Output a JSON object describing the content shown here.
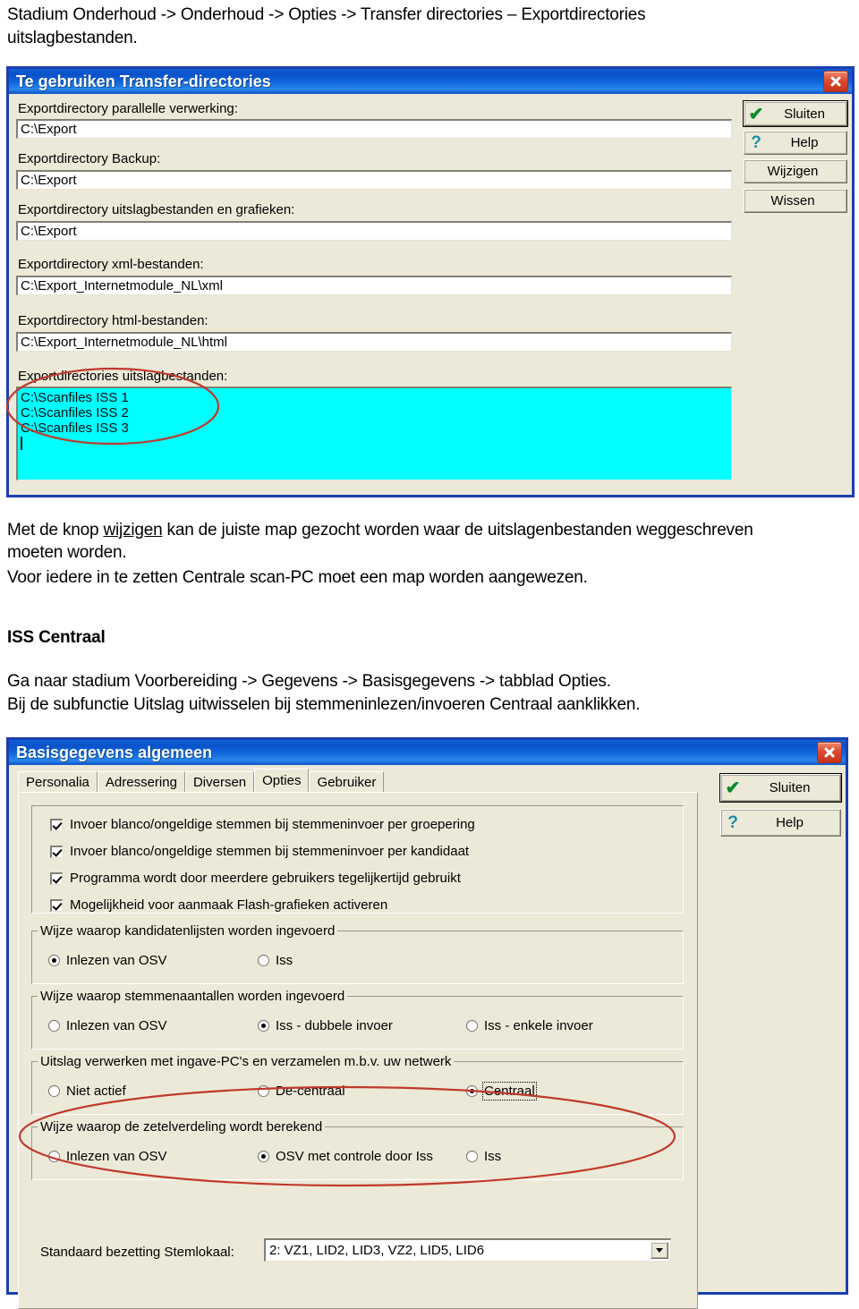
{
  "doc": {
    "intro_line1": "Stadium Onderhoud -> Onderhoud -> Opties -> Transfer directories – Exportdirectories",
    "intro_line2": "uitslagbestanden.",
    "para1_pre": "Met de knop ",
    "para1_link": "wijzigen",
    "para1_post": " kan de juiste map gezocht worden waar de uitslagenbestanden  weggeschreven",
    "para1_line2": "moeten worden.",
    "para2": "Voor iedere in te zetten Centrale scan-PC moet een map worden aangewezen.",
    "heading": "ISS Centraal",
    "para3": "Ga naar stadium Voorbereiding -> Gegevens -> Basisgegevens -> tabblad Opties.",
    "para4": "Bij de subfunctie Uitslag uitwisselen bij stemmeninlezen/invoeren Centraal aanklikken."
  },
  "dialog1": {
    "title": "Te gebruiken Transfer-directories",
    "close_icon": "close-icon",
    "fields": [
      {
        "label": "Exportdirectory parallelle verwerking:",
        "value": "C:\\Export"
      },
      {
        "label": "Exportdirectory Backup:",
        "value": "C:\\Export"
      },
      {
        "label": "Exportdirectory uitslagbestanden en grafieken:",
        "value": "C:\\Export"
      },
      {
        "label": "Exportdirectory xml-bestanden:",
        "value": "C:\\Export_Internetmodule_NL\\xml"
      },
      {
        "label": "Exportdirectory html-bestanden:",
        "value": "C:\\Export_Internetmodule_NL\\html"
      }
    ],
    "list_label": "Exportdirectories uitslagbestanden:",
    "list_items": [
      "C:\\Scanfiles ISS 1",
      "C:\\Scanfiles ISS 2",
      "C:\\Scanfiles ISS 3"
    ],
    "list_bg_color": "#00ffff",
    "buttons": [
      {
        "label": "Sluiten",
        "icon": "checkmark-icon",
        "glyph": "✔",
        "default": true
      },
      {
        "label": "Help",
        "icon": "question-mark-icon",
        "glyph": "?",
        "default": false
      },
      {
        "label": "Wijzigen",
        "icon": "",
        "glyph": "",
        "default": false
      },
      {
        "label": "Wissen",
        "icon": "",
        "glyph": "",
        "default": false
      }
    ]
  },
  "dialog2": {
    "title": "Basisgegevens algemeen",
    "close_icon": "close-icon",
    "tabs": [
      {
        "label": "Personalia",
        "active": false
      },
      {
        "label": "Adressering",
        "active": false
      },
      {
        "label": "Diversen",
        "active": false
      },
      {
        "label": "Opties",
        "active": true
      },
      {
        "label": "Gebruiker",
        "active": false
      }
    ],
    "checkboxes": [
      {
        "label": "Invoer blanco/ongeldige stemmen bij stemmeninvoer per groepering",
        "checked": true
      },
      {
        "label": "Invoer blanco/ongeldige stemmen bij stemmeninvoer per kandidaat",
        "checked": true
      },
      {
        "label": "Programma wordt door meerdere gebruikers tegelijkertijd gebruikt",
        "checked": true
      },
      {
        "label": "Mogelijkheid voor aanmaak Flash-grafieken activeren",
        "checked": true
      }
    ],
    "groups": [
      {
        "title": "Wijze waarop kandidatenlijsten worden ingevoerd",
        "options": [
          {
            "label": "Inlezen van OSV",
            "selected": true,
            "focused": false
          },
          {
            "label": "Iss",
            "selected": false,
            "focused": false
          }
        ]
      },
      {
        "title": "Wijze waarop stemmenaantallen worden ingevoerd",
        "options": [
          {
            "label": "Inlezen van OSV",
            "selected": false,
            "focused": false
          },
          {
            "label": "Iss - dubbele invoer",
            "selected": true,
            "focused": false
          },
          {
            "label": "Iss - enkele invoer",
            "selected": false,
            "focused": false
          }
        ]
      },
      {
        "title": "Uitslag verwerken met ingave-PC's en verzamelen m.b.v. uw netwerk",
        "options": [
          {
            "label": "Niet actief",
            "selected": false,
            "focused": false
          },
          {
            "label": "De-centraal",
            "selected": false,
            "focused": false
          },
          {
            "label": "Centraal",
            "selected": true,
            "focused": true
          }
        ]
      },
      {
        "title": "Wijze waarop de zetelverdeling wordt berekend",
        "options": [
          {
            "label": "Inlezen van OSV",
            "selected": false,
            "focused": false
          },
          {
            "label": "OSV met controle door Iss",
            "selected": true,
            "focused": false
          },
          {
            "label": "Iss",
            "selected": false,
            "focused": false
          }
        ]
      }
    ],
    "combo": {
      "label": "Standaard bezetting Stemlokaal:",
      "value": "2: VZ1, LID2, LID3, VZ2, LID5, LID6"
    },
    "buttons": [
      {
        "label": "Sluiten",
        "icon": "checkmark-icon",
        "glyph": "✔",
        "default": true
      },
      {
        "label": "Help",
        "icon": "question-mark-icon",
        "glyph": "?",
        "default": false
      }
    ]
  },
  "annotations": {
    "accent_color": "#c0392b",
    "ellipse1_name": "red-ellipse-highlight-exportdirectories",
    "ellipse2_name": "red-ellipse-highlight-centraal"
  }
}
